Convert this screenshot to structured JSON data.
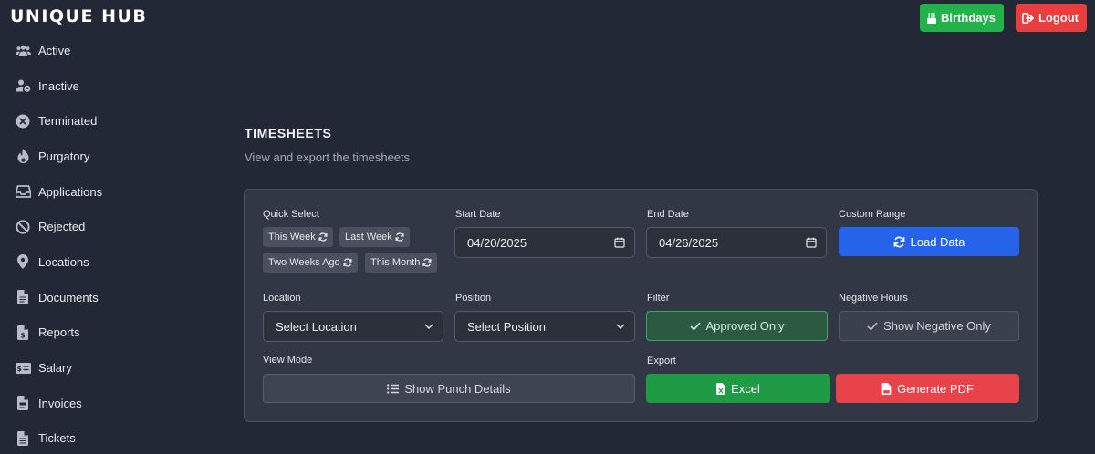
{
  "brand": "UNIQUE HUB",
  "header": {
    "birthdays_label": "Birthdays",
    "logout_label": "Logout"
  },
  "sidebar": {
    "items": [
      {
        "label": "Active",
        "icon": "users-icon"
      },
      {
        "label": "Inactive",
        "icon": "user-clock-icon"
      },
      {
        "label": "Terminated",
        "icon": "circle-x-icon"
      },
      {
        "label": "Purgatory",
        "icon": "fire-icon"
      },
      {
        "label": "Applications",
        "icon": "inbox-icon"
      },
      {
        "label": "Rejected",
        "icon": "ban-icon"
      },
      {
        "label": "Locations",
        "icon": "map-pin-icon"
      },
      {
        "label": "Documents",
        "icon": "file-icon"
      },
      {
        "label": "Reports",
        "icon": "file-invoice-dollar-icon"
      },
      {
        "label": "Salary",
        "icon": "money-check-icon"
      },
      {
        "label": "Invoices",
        "icon": "file-invoice-icon"
      },
      {
        "label": "Tickets",
        "icon": "file-lines-icon"
      }
    ]
  },
  "page": {
    "title": "TIMESHEETS",
    "subtitle": "View and export the timesheets"
  },
  "filters": {
    "quick_select": {
      "label": "Quick Select",
      "options": [
        "This Week",
        "Last Week",
        "Two Weeks Ago",
        "This Month"
      ]
    },
    "start_date": {
      "label": "Start Date",
      "value": "04/20/2025"
    },
    "end_date": {
      "label": "End Date",
      "value": "04/26/2025"
    },
    "custom_range": {
      "label": "Custom Range",
      "button": "Load Data"
    },
    "location": {
      "label": "Location",
      "value": "Select Location"
    },
    "position": {
      "label": "Position",
      "value": "Select Position"
    },
    "filter": {
      "label": "Filter",
      "button": "Approved Only"
    },
    "negative_hours": {
      "label": "Negative Hours",
      "button": "Show Negative Only"
    },
    "view_mode": {
      "label": "View Mode",
      "button": "Show Punch Details"
    },
    "export": {
      "label": "Export",
      "excel": "Excel",
      "pdf": "Generate PDF"
    }
  },
  "colors": {
    "background": "#222835",
    "panel": "#313744",
    "accent_blue": "#2563eb",
    "success_green": "#21b24a",
    "danger_red": "#ea3d3d"
  }
}
